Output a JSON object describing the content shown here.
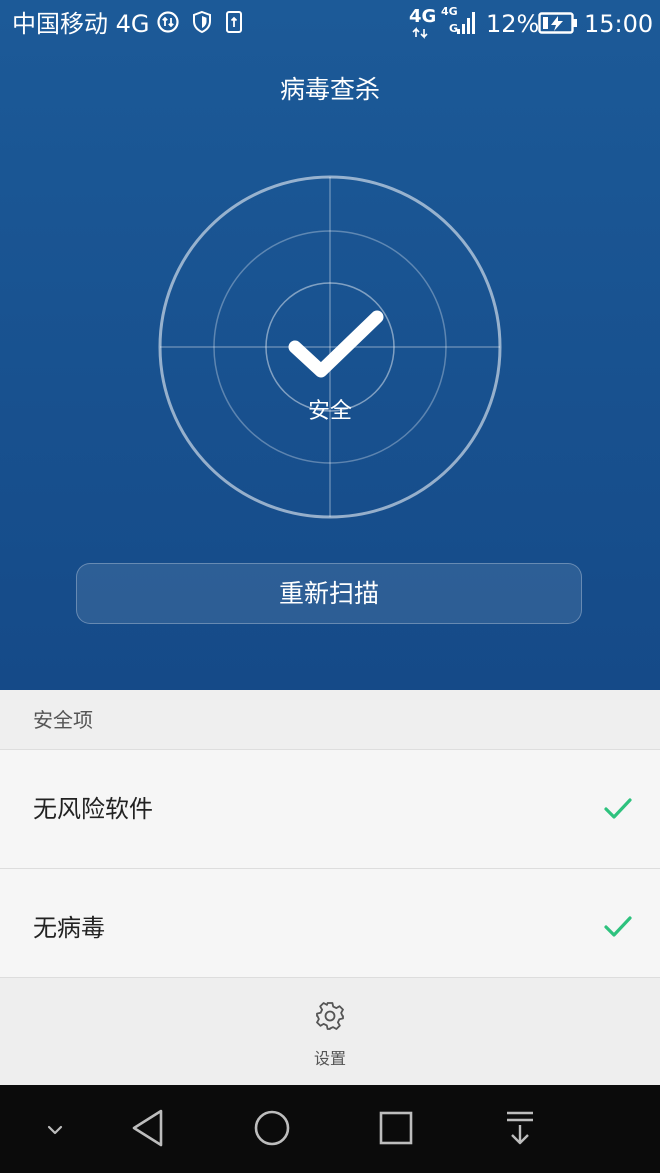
{
  "status_bar": {
    "carrier": "中国移动 4G",
    "network_left": "4G",
    "network_right_top": "4G",
    "network_right_bottom": "G",
    "battery": "12%",
    "time": "15:00"
  },
  "header": {
    "title": "病毒查杀"
  },
  "scanner": {
    "status_label": "安全"
  },
  "actions": {
    "rescan_label": "重新扫描"
  },
  "security": {
    "section_title": "安全项",
    "items": [
      {
        "label": "无风险软件",
        "status": "ok"
      },
      {
        "label": "无病毒",
        "status": "ok"
      }
    ]
  },
  "bottom_bar": {
    "settings_label": "设置"
  },
  "colors": {
    "header_top": "#1c5a98",
    "header_bottom": "#154a88",
    "check_green": "#2ec27e",
    "nav_bg": "#0b0b0b"
  }
}
